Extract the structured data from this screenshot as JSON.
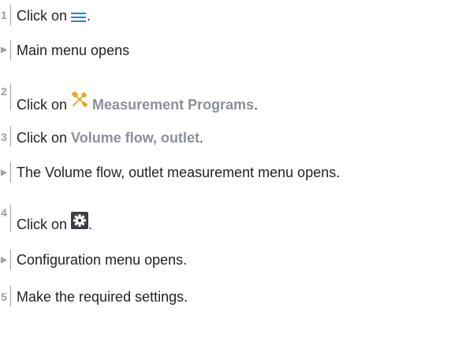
{
  "steps": [
    {
      "marker": "1",
      "type": "number",
      "prefix": "Click on ",
      "icon": "hamburger-menu-icon",
      "suffix": "."
    },
    {
      "marker": "▶",
      "type": "result",
      "text": "Main menu opens"
    },
    {
      "marker": "2",
      "type": "number",
      "prefix": "Click on ",
      "icon": "tools-icon",
      "highlight": "Measurement Programs",
      "suffix": "."
    },
    {
      "marker": "3",
      "type": "number",
      "prefix": "Click on ",
      "highlight": "Volume flow, outlet",
      "suffix": "."
    },
    {
      "marker": "▶",
      "type": "result",
      "text": "The Volume flow, outlet measurement menu opens."
    },
    {
      "marker": "4",
      "type": "number",
      "prefix": "Click on ",
      "icon": "gear-icon",
      "suffix": "."
    },
    {
      "marker": "▶",
      "type": "result",
      "text": "Configuration menu opens."
    },
    {
      "marker": "5",
      "type": "number",
      "text": "Make the required settings."
    }
  ],
  "colors": {
    "accent_icon": "#e8a317",
    "highlight_text": "#8a9099",
    "marker": "#9aa0a6"
  }
}
